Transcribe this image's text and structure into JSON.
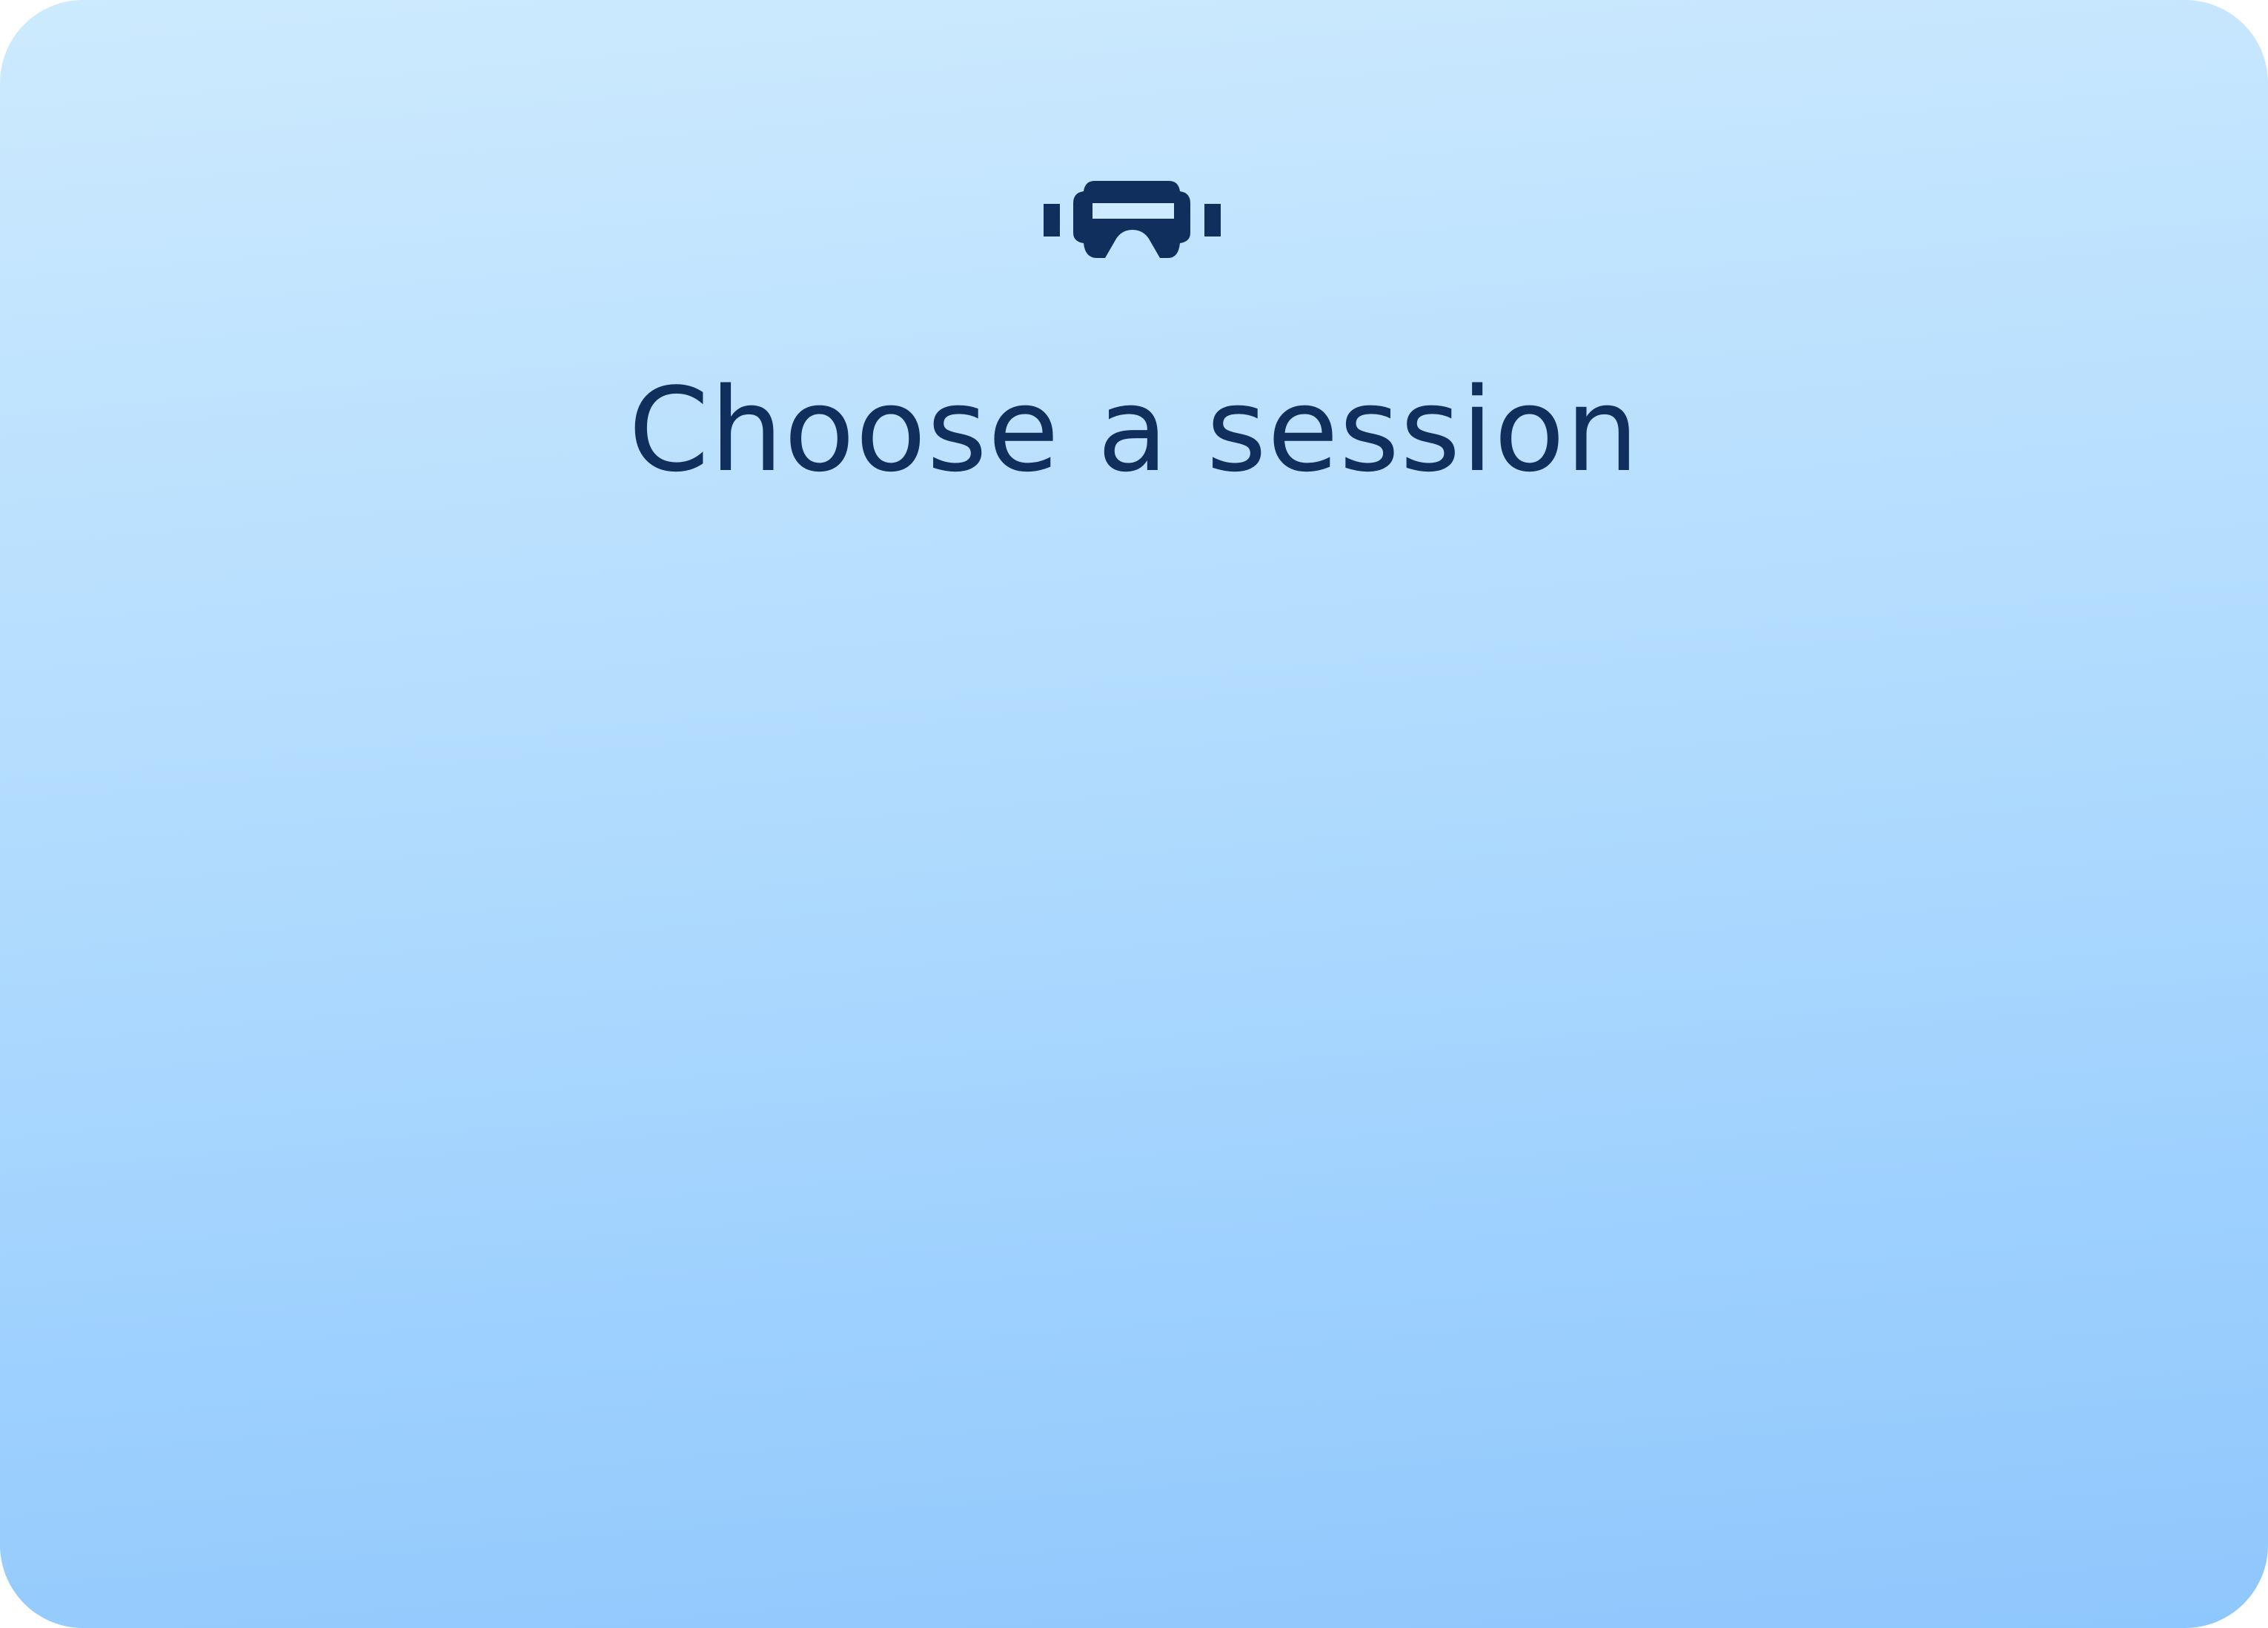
{
  "brand": {
    "logo_icon": "vr-headset-icon",
    "icon_color": "#112f5c"
  },
  "heading": {
    "title": "Choose a session"
  },
  "colors": {
    "background_top": "#cdeafe",
    "background_bottom": "#8ec7fd",
    "text": "#112f5c"
  }
}
